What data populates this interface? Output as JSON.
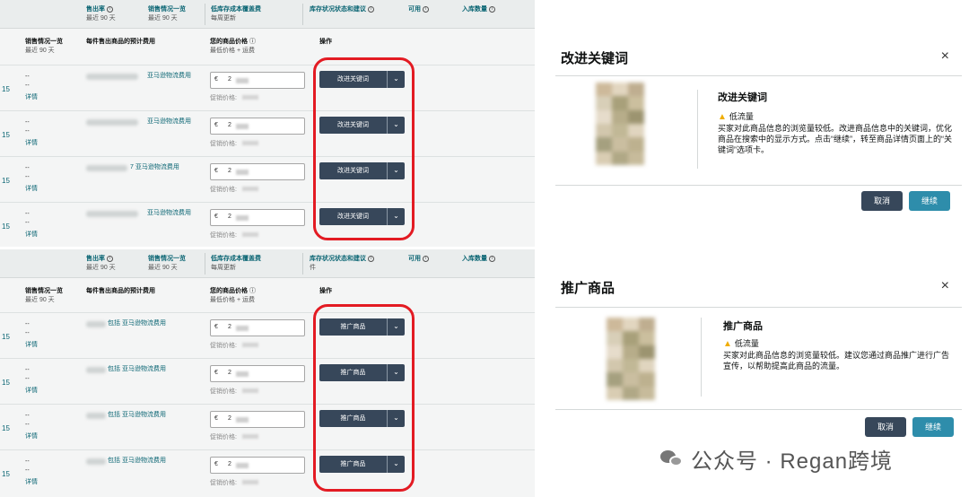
{
  "table_header_top": {
    "sell_through": {
      "title": "售出率",
      "sub": "最近 90 天"
    },
    "sales_overview": {
      "title": "销售情况一览",
      "sub": "最近 90 天"
    },
    "low_inventory_fee": {
      "title": "低库存成本覆盖费",
      "sub": "每周更新"
    },
    "inventory_status": {
      "title": "库存状况状态和建议",
      "sub": "件"
    },
    "available": {
      "title": "可用"
    },
    "inbound": {
      "title": "入库数量"
    }
  },
  "table_header_columns": {
    "sales_overview": {
      "title": "销售情况一览",
      "sub": "最近 90 天"
    },
    "estimated_fee": {
      "title": "每件售出商品的预计费用"
    },
    "your_price": {
      "title": "您的商品价格",
      "sub": "最低价格 + 运费"
    },
    "action": {
      "title": "操作"
    }
  },
  "info_icon": "ⓘ",
  "row_common": {
    "number": "15",
    "dash": "--",
    "detail": "详情",
    "currency": "€",
    "promo_label": "促销价格:",
    "dropdown_icon": "chevron-down-icon"
  },
  "table1": {
    "action_label": "改进关键词",
    "rows": [
      {
        "fee_text": "亚马逊物流费用",
        "price": "2"
      },
      {
        "fee_text": "亚马逊物流费用",
        "price": "2"
      },
      {
        "fee_text": "7 亚马逊物流费用",
        "price": "2"
      },
      {
        "fee_text": "亚马逊物流费用",
        "price": "2"
      }
    ]
  },
  "table2": {
    "action_label": "推广商品",
    "rows": [
      {
        "fee_text": "包括      亚马逊物流费用",
        "price": "2"
      },
      {
        "fee_text": "包括      亚马逊物流费用",
        "price": "2"
      },
      {
        "fee_text": "包括      亚马逊物流费用",
        "price": "2"
      },
      {
        "fee_text": "包括      亚马逊物流费用",
        "price": "2"
      }
    ]
  },
  "modal_keywords": {
    "title": "改进关键词",
    "heading": "改进关键词",
    "warning": "低流量",
    "description": "买家对此商品信息的浏览量较低。改进商品信息中的关键词，优化商品在搜索中的显示方式。点击“继续”，转至商品详情页面上的“关键词”选项卡。",
    "cancel": "取消",
    "continue": "继续",
    "close": "×"
  },
  "modal_promote": {
    "title": "推广商品",
    "heading": "推广商品",
    "warning": "低流量",
    "description": "买家对此商品信息的浏览量较低。建议您通过商品推广进行广告宣传，以帮助提高此商品的流量。",
    "cancel": "取消",
    "continue": "继续",
    "close": "×"
  },
  "watermark": {
    "text": "公众号 · Regan跨境"
  },
  "colors": {
    "accent": "#0a6573",
    "button_dark": "#37475a",
    "button_primary": "#2e8dab",
    "highlight": "#e31b23",
    "warning": "#f0ad00"
  }
}
